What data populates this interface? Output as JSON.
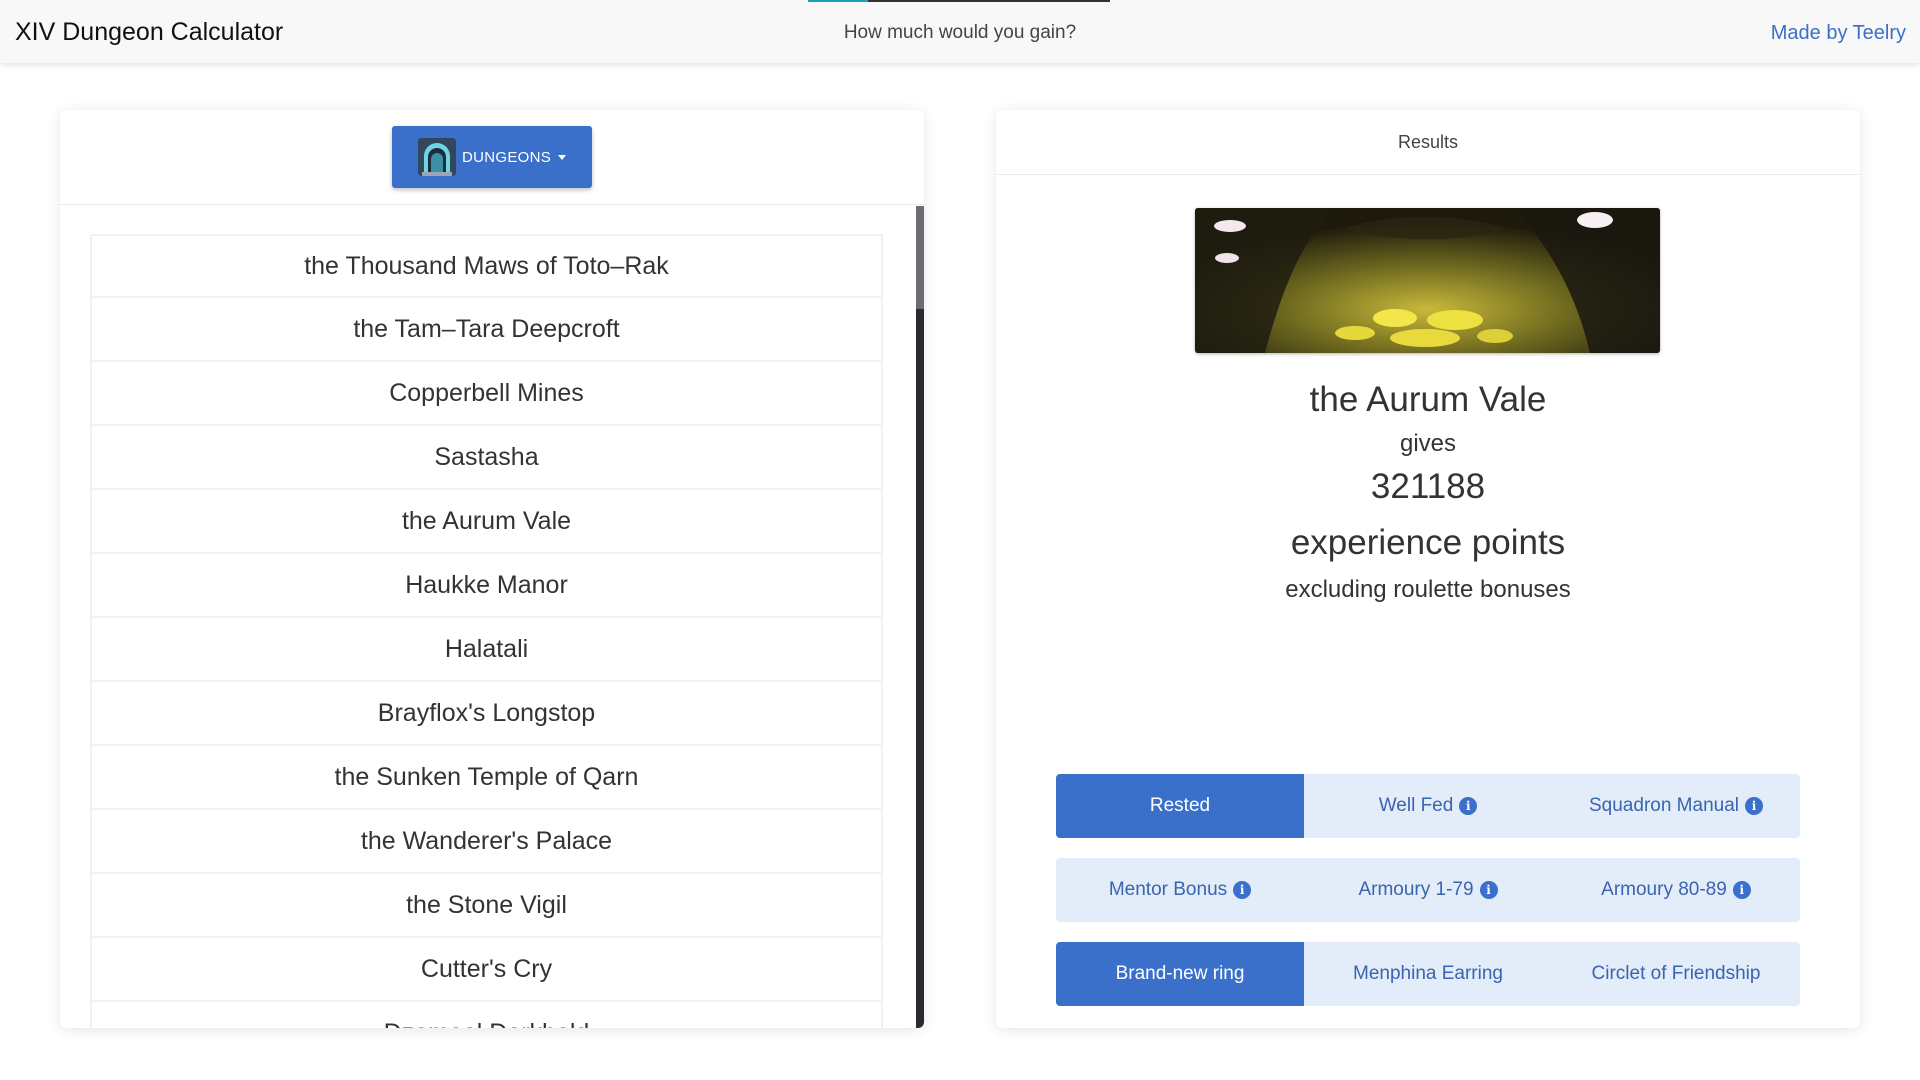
{
  "navbar": {
    "brand": "XIV Dungeon Calculator",
    "tagline": "How much would you gain?",
    "credit": "Made by Teelry",
    "progress_fraction": 0.2
  },
  "left_panel": {
    "dropdown_label": "DUNGEONS",
    "dropdown_icon": "dungeon-gate-icon",
    "dungeons": [
      "the Thousand Maws of Toto–Rak",
      "the Tam–Tara Deepcroft",
      "Copperbell Mines",
      "Sastasha",
      "the Aurum Vale",
      "Haukke Manor",
      "Halatali",
      "Brayflox's Longstop",
      "the Sunken Temple of Qarn",
      "the Wanderer's Palace",
      "the Stone Vigil",
      "Cutter's Cry",
      "Dzemael Darkhold"
    ],
    "scroll_fraction": 0.12
  },
  "results": {
    "header": "Results",
    "dungeon_name": "the Aurum Vale",
    "gives_text": "gives",
    "xp_value": "321188",
    "xp_unit": "experience points",
    "note": "excluding roulette bonuses",
    "bonus_rows": [
      [
        {
          "label": "Rested",
          "active": true,
          "info": false
        },
        {
          "label": "Well Fed",
          "active": false,
          "info": true
        },
        {
          "label": "Squadron Manual",
          "active": false,
          "info": true
        }
      ],
      [
        {
          "label": "Mentor Bonus",
          "active": false,
          "info": true
        },
        {
          "label": "Armoury 1-79",
          "active": false,
          "info": true
        },
        {
          "label": "Armoury 80-89",
          "active": false,
          "info": true
        }
      ],
      [
        {
          "label": "Brand-new ring",
          "active": true,
          "info": false
        },
        {
          "label": "Menphina Earring",
          "active": false,
          "info": false
        },
        {
          "label": "Circlet of Friendship",
          "active": false,
          "info": false
        }
      ]
    ]
  },
  "colors": {
    "accent": "#3a70c9",
    "accent_light": "#e3ecf9",
    "progress": "#17a2b8"
  }
}
